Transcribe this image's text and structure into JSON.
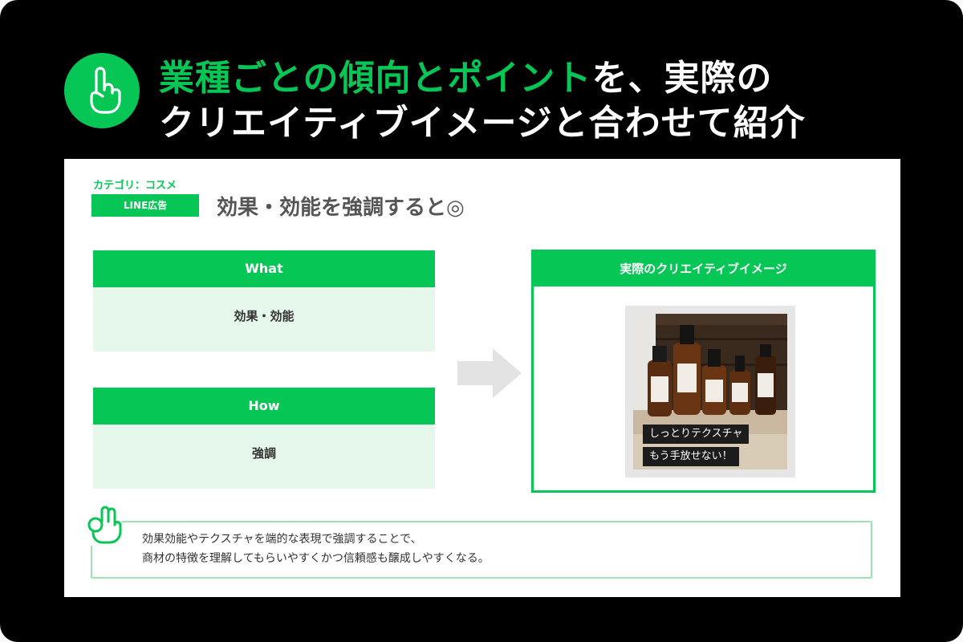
{
  "header": {
    "title_highlight": "業種ごとの傾向とポイント",
    "title_rest": "を、実際の",
    "title_line2": "クリエイティブイメージと合わせて紹介"
  },
  "slide": {
    "category": "カテゴリ：コスメ",
    "tag": "LINE広告",
    "title": "効果・効能を強調すると◎",
    "what": {
      "label": "What",
      "text": "効果・効能"
    },
    "how": {
      "label": "How",
      "text": "強調"
    },
    "creative": {
      "label": "実際のクリエイティブイメージ",
      "caption_1": "しっとりテクスチャ",
      "caption_2": "もう手放せない！"
    },
    "message": {
      "line_1": "効果効能やテクスチャを端的な表現で強調することで、",
      "line_2": "商材の特徴を理解してもらいやすくかつ信頼感も醸成しやすくなる。"
    }
  },
  "colors": {
    "accent": "#06c755",
    "light_bg": "#e6f8ec",
    "frame": "#000000"
  },
  "icons": [
    "pointing-hand-icon",
    "arrow-right-icon",
    "ok-hand-icon"
  ]
}
